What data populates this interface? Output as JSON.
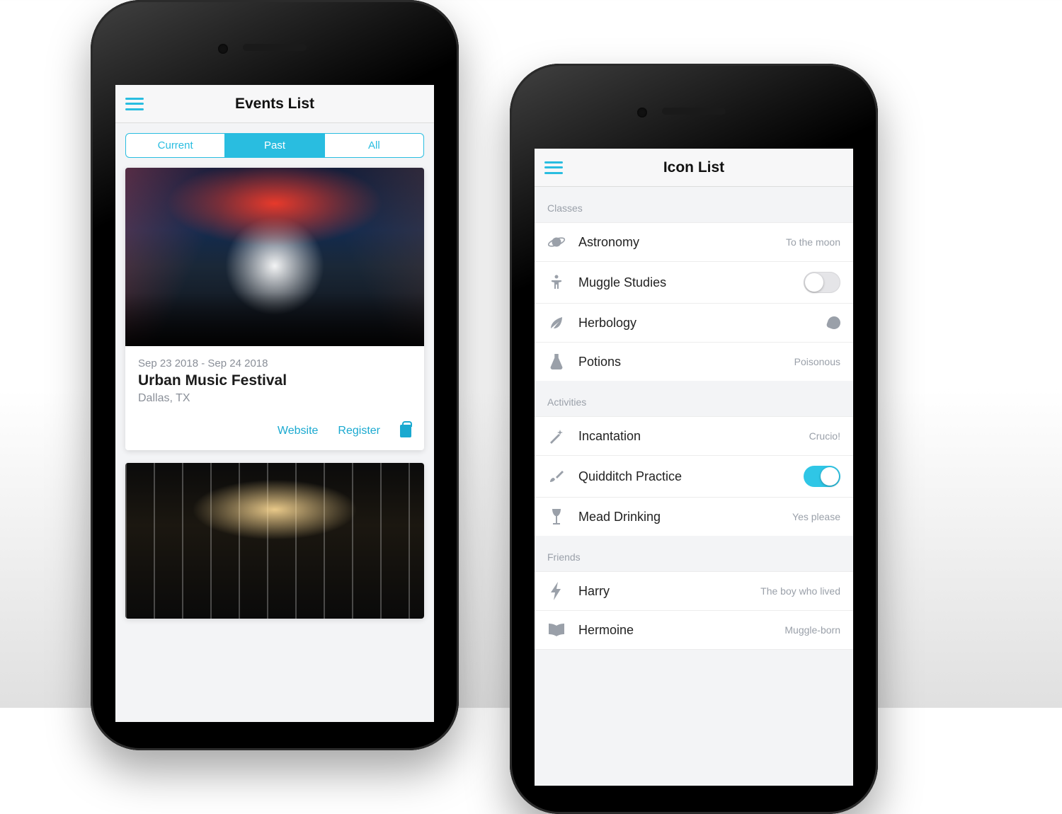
{
  "events": {
    "title": "Events List",
    "tabs": {
      "current": "Current",
      "past": "Past",
      "all": "All"
    },
    "card1": {
      "date": "Sep 23 2018 - Sep 24 2018",
      "title": "Urban Music Festival",
      "location": "Dallas, TX",
      "website": "Website",
      "register": "Register"
    }
  },
  "iconlist": {
    "title": "Icon List",
    "sections": {
      "classes": {
        "label": "Classes",
        "astronomy": {
          "label": "Astronomy",
          "trail": "To the moon"
        },
        "muggle": {
          "label": "Muggle Studies"
        },
        "herbology": {
          "label": "Herbology"
        },
        "potions": {
          "label": "Potions",
          "trail": "Poisonous"
        }
      },
      "activities": {
        "label": "Activities",
        "incantation": {
          "label": "Incantation",
          "trail": "Crucio!"
        },
        "quidditch": {
          "label": "Quidditch Practice"
        },
        "mead": {
          "label": "Mead Drinking",
          "trail": "Yes please"
        }
      },
      "friends": {
        "label": "Friends",
        "harry": {
          "label": "Harry",
          "trail": "The boy who lived"
        },
        "hermoine": {
          "label": "Hermoine",
          "trail": "Muggle-born"
        }
      }
    }
  }
}
